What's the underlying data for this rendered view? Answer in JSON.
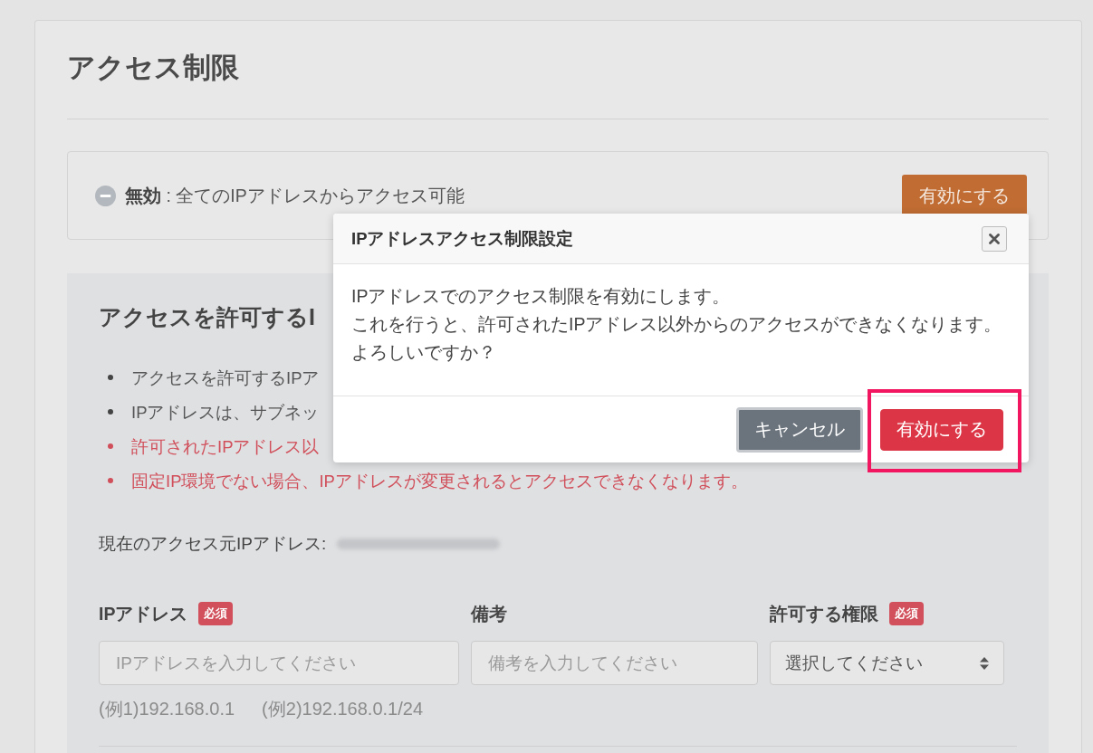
{
  "page": {
    "title": "アクセス制限"
  },
  "status": {
    "enabled": false,
    "text": "**無効** : 全てのIPアドレスからアクセス可能",
    "button": "有効にする"
  },
  "allowed_ip_section": {
    "heading": "アクセスを許可するI",
    "notes": [
      {
        "kind": "info",
        "text": "アクセスを許可するIPア"
      },
      {
        "kind": "info",
        "text": "IPアドレスは、サブネッ"
      },
      {
        "kind": "warning",
        "text": "許可されたIPアドレス以"
      },
      {
        "kind": "warning",
        "text": "固定IP環境でない場合、IPアドレスが変更されるとアクセスできなくなります。"
      }
    ],
    "current_ip_label": "現在のアクセス元IPアドレス:",
    "fields": [
      {
        "kind": "text",
        "label": "IPアドレス",
        "badge": "必須",
        "placeholder": "IPアドレスを入力してください"
      },
      {
        "kind": "text",
        "label": "備考",
        "placeholder": "備考を入力してください"
      },
      {
        "kind": "select",
        "label": "許可する権限",
        "badge": "必須",
        "value": "選択してください"
      }
    ],
    "examples": [
      "(例1)192.168.0.1",
      "(例2)192.168.0.1/24"
    ]
  },
  "modal": {
    "title": "IPアドレスアクセス制限設定",
    "message_lines": [
      "IPアドレスでのアクセス制限を有効にします。",
      "これを行うと、許可されたIPアドレス以外からのアクセスができなくなります。",
      "よろしいですか？"
    ],
    "buttons": [
      {
        "kind": "secondary",
        "label": "キャンセル",
        "focused": true,
        "highlighted": false
      },
      {
        "kind": "danger",
        "label": "有効にする",
        "focused": false,
        "highlighted": true
      }
    ]
  }
}
